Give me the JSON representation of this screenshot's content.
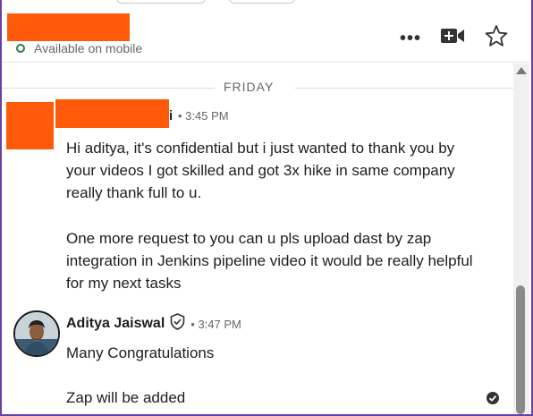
{
  "header": {
    "status": "Available on mobile",
    "icons": [
      "more-icon",
      "video-call-icon",
      "star-icon"
    ]
  },
  "thread": {
    "day_divider": "FRIDAY",
    "message1": {
      "sender_tail": "i",
      "time": "• 3:45 PM",
      "paragraph1": "Hi aditya, it's confidential but i just wanted to thank you by your videos I got skilled and got 3x hike in same company really thank full to u.",
      "paragraph2": "One more request to you can u pls upload dast by zap integration in Jenkins pipeline video it would be really helpful for my next tasks"
    },
    "message2": {
      "sender": "Aditya Jaiswal",
      "time": "• 3:47 PM",
      "paragraph1": "Many Congratulations",
      "paragraph2": "Zap will be added"
    }
  },
  "colors": {
    "redaction": "#ff5a0a",
    "frame": "#6b3fa6",
    "online": "#2e7d4f"
  }
}
